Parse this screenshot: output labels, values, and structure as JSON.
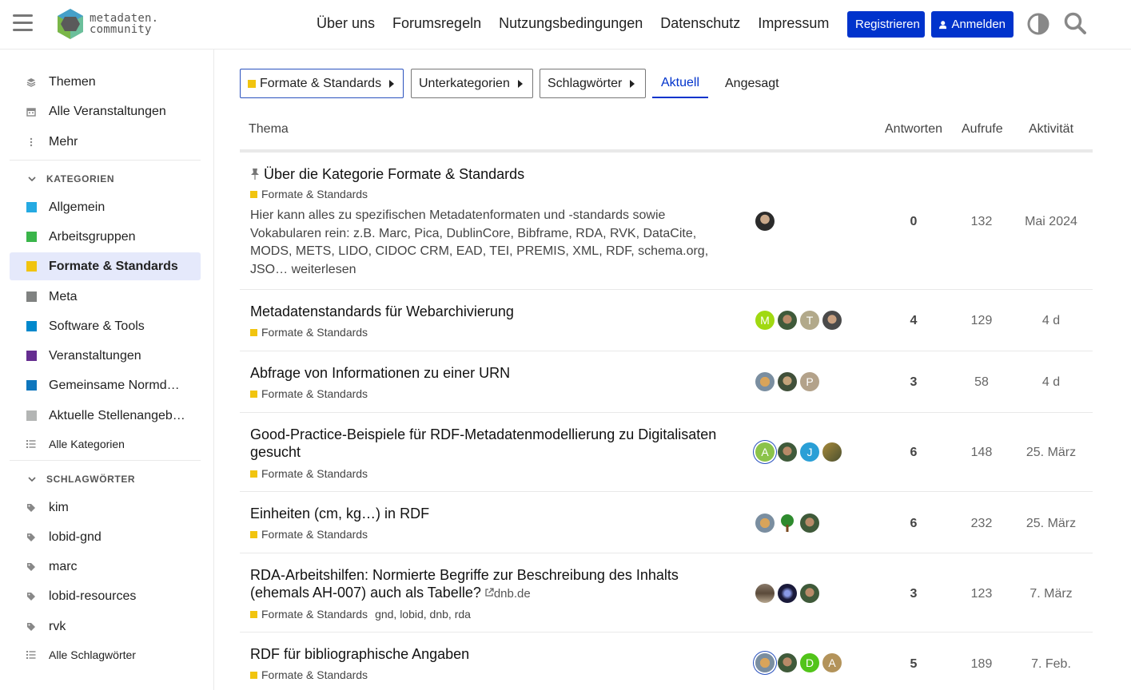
{
  "header": {
    "logo_line1": "metadaten.",
    "logo_line2": "community",
    "nav": [
      "Über uns",
      "Forumsregeln",
      "Nutzungsbedingungen",
      "Datenschutz",
      "Impressum"
    ],
    "register_label": "Registrieren",
    "login_label": "Anmelden"
  },
  "sidebar": {
    "top": [
      {
        "label": "Themen",
        "icon": "layers-icon"
      },
      {
        "label": "Alle Veranstaltungen",
        "icon": "calendar-icon"
      },
      {
        "label": "Mehr",
        "icon": "more-vertical-icon"
      }
    ],
    "categories_heading": "KATEGORIEN",
    "categories": [
      {
        "label": "Allgemein",
        "color": "#25aae2"
      },
      {
        "label": "Arbeitsgruppen",
        "color": "#3ab54a"
      },
      {
        "label": "Formate & Standards",
        "color": "#f1c40f"
      },
      {
        "label": "Meta",
        "color": "#808281"
      },
      {
        "label": "Software & Tools",
        "color": "#0088cc"
      },
      {
        "label": "Veranstaltungen",
        "color": "#652d90"
      },
      {
        "label": "Gemeinsame Normdateien",
        "color": "#0e76bd"
      },
      {
        "label": "Aktuelle Stellenangebote",
        "color": "#b3b5b4"
      }
    ],
    "all_categories": "Alle Kategorien",
    "tags_heading": "SCHLAGWÖRTER",
    "tags": [
      "kim",
      "lobid-gnd",
      "marc",
      "lobid-resources",
      "rvk"
    ],
    "all_tags": "Alle Schlagwörter"
  },
  "filters": {
    "category": "Formate & Standards",
    "subcategories": "Unterkategorien",
    "tags": "Schlagwörter",
    "tab_latest": "Aktuell",
    "tab_hot": "Angesagt"
  },
  "table": {
    "col_topic": "Thema",
    "col_replies": "Antworten",
    "col_views": "Aufrufe",
    "col_activity": "Aktivität"
  },
  "topics": [
    {
      "title": "Über die Kategorie Formate & Standards",
      "category": "Formate & Standards",
      "excerpt": "Hier kann alles zu spezifischen Metadatenformaten und -standards sowie Vokabularen rein: z.B. Marc, Pica, DublinCore, Bibframe, RDA, RVK, DataCite, MODS, METS, LIDO, CIDOC CRM, EAD, TEI, PREMIS, XML, RDF, schema.org, JSO… weiterlesen",
      "replies": "0",
      "views": "132",
      "activity": "Mai 2024"
    },
    {
      "title": "Metadatenstandards für Webarchivierung",
      "category": "Formate & Standards",
      "replies": "4",
      "views": "129",
      "activity": "4 d"
    },
    {
      "title": "Abfrage von Informationen zu einer URN",
      "category": "Formate & Standards",
      "replies": "3",
      "views": "58",
      "activity": "4 d"
    },
    {
      "title_line1": "Good-Practice-Beispiele für RDF-Metadatenmodellierung zu Digitalisaten",
      "title_line2": "gesucht",
      "category": "Formate & Standards",
      "replies": "6",
      "views": "148",
      "activity": "25. März"
    },
    {
      "title": "Einheiten (cm, kg…) in RDF",
      "category": "Formate & Standards",
      "replies": "6",
      "views": "232",
      "activity": "25. März"
    },
    {
      "title_line1": "RDA-Arbeitshilfen: Normierte Begriffe zur Beschreibung des Inhalts",
      "title_line2": "(ehemals AH-007) auch als Tabelle?",
      "link_domain": "dnb.de",
      "category": "Formate & Standards",
      "tags": "gnd, lobid, dnb, rda",
      "replies": "3",
      "views": "123",
      "activity": "7. März"
    },
    {
      "title": "RDF für bibliographische Angaben",
      "category": "Formate & Standards",
      "replies": "5",
      "views": "189",
      "activity": "7. Feb."
    }
  ],
  "avatar_letters": {
    "r2_a1": "M",
    "r2_a3": "T",
    "r3_a3": "P",
    "r4_a1": "A",
    "r4_a3": "J",
    "r7_a3": "D",
    "r7_a4": "A"
  }
}
